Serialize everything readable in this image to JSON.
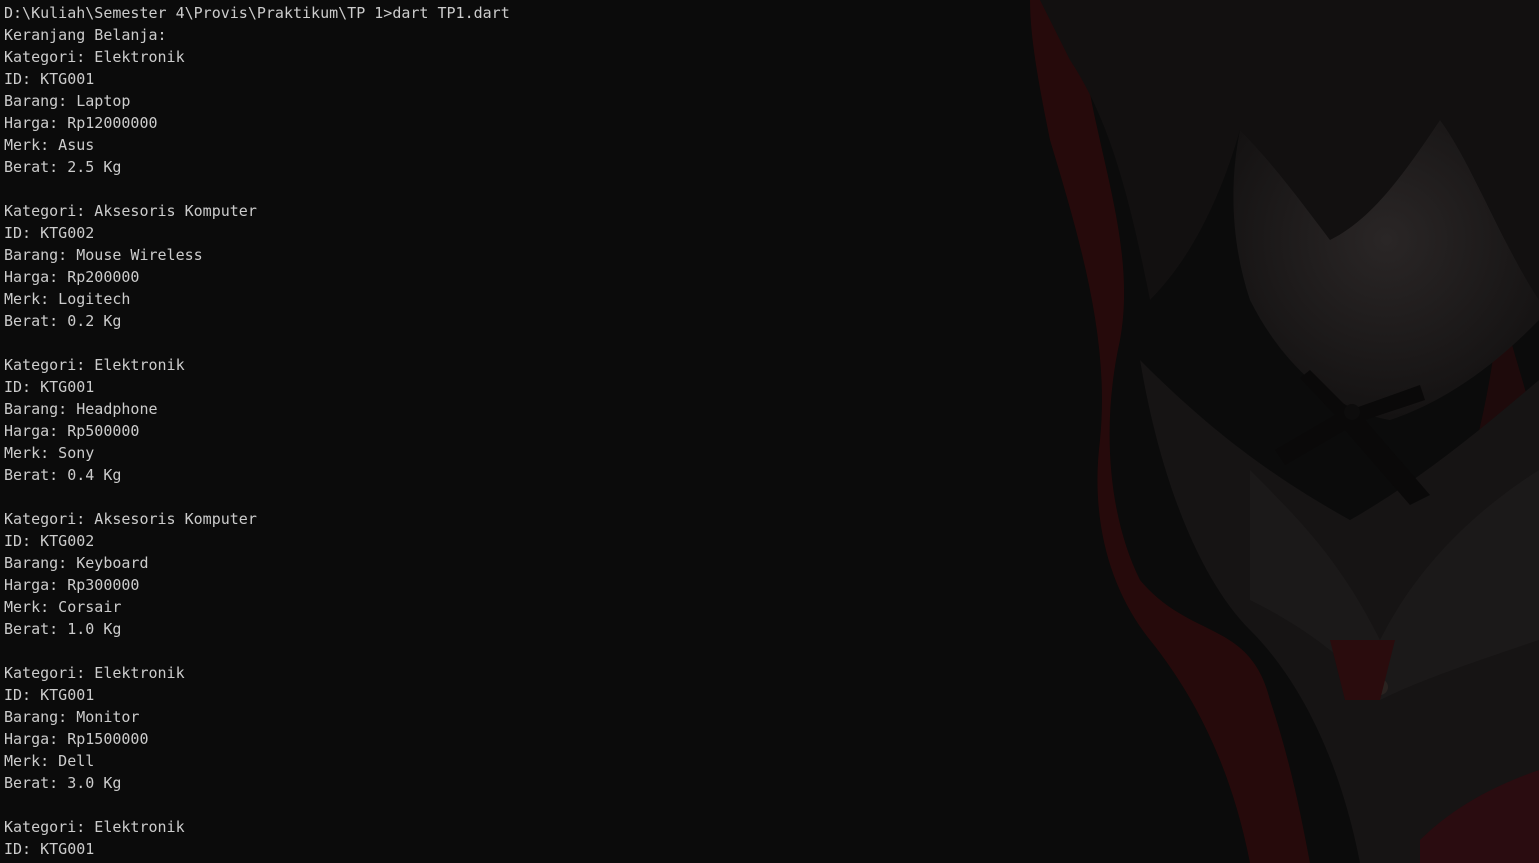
{
  "terminal": {
    "background_color": "#0b0b0b",
    "text_color": "#cccccc",
    "lines": [
      "D:\\Kuliah\\Semester 4\\Provis\\Praktikum\\TP 1>dart TP1.dart",
      "Keranjang Belanja:",
      "Kategori: Elektronik",
      "ID: KTG001",
      "Barang: Laptop",
      "Harga: Rp12000000",
      "Merk: Asus",
      "Berat: 2.5 Kg",
      "",
      "Kategori: Aksesoris Komputer",
      "ID: KTG002",
      "Barang: Mouse Wireless",
      "Harga: Rp200000",
      "Merk: Logitech",
      "Berat: 0.2 Kg",
      "",
      "Kategori: Elektronik",
      "ID: KTG001",
      "Barang: Headphone",
      "Harga: Rp500000",
      "Merk: Sony",
      "Berat: 0.4 Kg",
      "",
      "Kategori: Aksesoris Komputer",
      "ID: KTG002",
      "Barang: Keyboard",
      "Harga: Rp300000",
      "Merk: Corsair",
      "Berat: 1.0 Kg",
      "",
      "Kategori: Elektronik",
      "ID: KTG001",
      "Barang: Monitor",
      "Harga: Rp1500000",
      "Merk: Dell",
      "Berat: 3.0 Kg",
      "",
      "Kategori: Elektronik",
      "ID: KTG001"
    ]
  },
  "wallpaper": {
    "icon": "anime-character-silhouette",
    "accent_color": "#3a0e10"
  }
}
